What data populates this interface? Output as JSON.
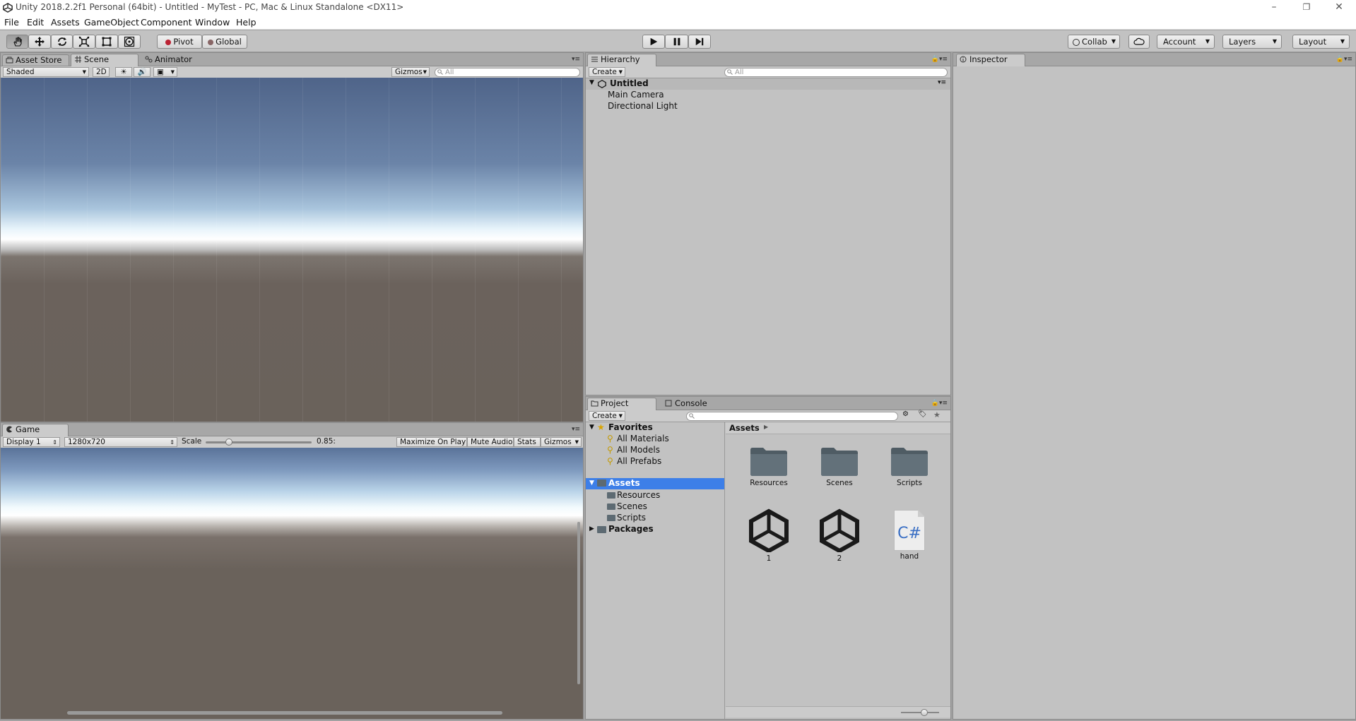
{
  "window": {
    "title": "Unity 2018.2.2f1 Personal (64bit) - Untitled - MyTest - PC, Mac & Linux Standalone <DX11>",
    "minimize": "–",
    "restore": "❐",
    "close": "✕"
  },
  "menu": [
    "File",
    "Edit",
    "Assets",
    "GameObject",
    "Component",
    "Window",
    "Help"
  ],
  "toolbar": {
    "tools": [
      "hand-tool-icon",
      "move-tool-icon",
      "rotate-tool-icon",
      "scale-tool-icon",
      "rect-tool-icon",
      "transform-tool-icon"
    ],
    "pivot": "Pivot",
    "global": "Global",
    "collab": "Collab",
    "account": "Account",
    "layers": "Layers",
    "layout": "Layout"
  },
  "scene_panel": {
    "tabs": [
      "Asset Store",
      "Scene",
      "Animator"
    ],
    "shading": "Shaded",
    "mode2d": "2D",
    "gizmos": "Gizmos",
    "search_placeholder": "All"
  },
  "game_panel": {
    "tab": "Game",
    "display": "Display 1",
    "resolution": "1280x720",
    "scale_label": "Scale",
    "scale_value": "0.85:",
    "scale_fraction": 0.2,
    "maximize": "Maximize On Play",
    "mute": "Mute Audio",
    "stats": "Stats",
    "gizmos": "Gizmos"
  },
  "hierarchy": {
    "tab": "Hierarchy",
    "create": "Create",
    "search_placeholder": "All",
    "scene": "Untitled",
    "items": [
      "Main Camera",
      "Directional Light"
    ]
  },
  "inspector": {
    "tab": "Inspector"
  },
  "project": {
    "tabs": [
      "Project",
      "Console"
    ],
    "create": "Create",
    "favorites": "Favorites",
    "favorite_items": [
      "All Materials",
      "All Models",
      "All Prefabs"
    ],
    "assets": "Assets",
    "asset_folders": [
      "Resources",
      "Scenes",
      "Scripts"
    ],
    "packages": "Packages",
    "breadcrumb": "Assets",
    "tiles": [
      {
        "label": "Resources",
        "icon": "folder-icon"
      },
      {
        "label": "Scenes",
        "icon": "folder-icon"
      },
      {
        "label": "Scripts",
        "icon": "folder-icon"
      },
      {
        "label": "1",
        "icon": "unity-scene-icon"
      },
      {
        "label": "2",
        "icon": "unity-scene-icon"
      },
      {
        "label": "hand",
        "icon": "csharp-script-icon"
      }
    ],
    "csharp_glyph": "C#"
  },
  "colors": {
    "panel": "#c2c2c2",
    "selection": "#3d7fe8",
    "folder": "#5d6a72",
    "sky": "#4f6489",
    "ground": "#6a625b"
  }
}
